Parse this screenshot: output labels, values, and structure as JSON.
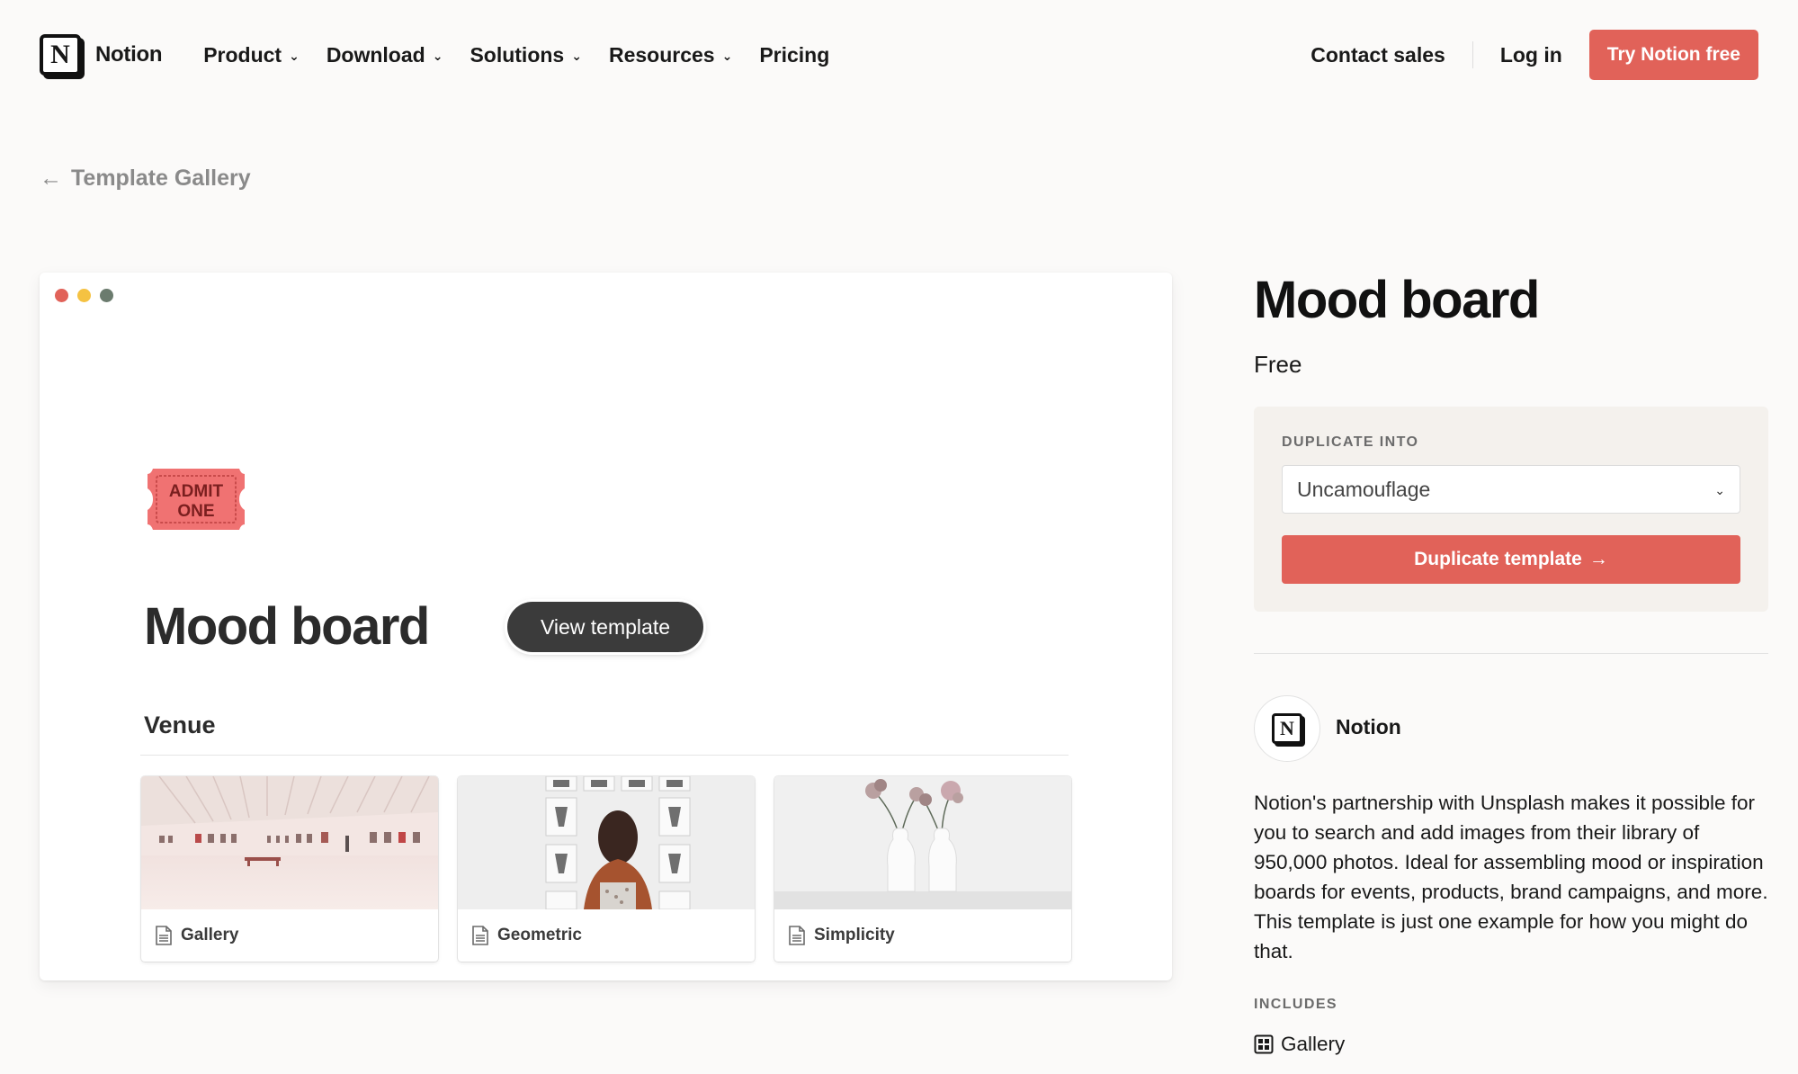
{
  "nav": {
    "brand": "Notion",
    "menu": [
      {
        "label": "Product",
        "has_dropdown": true
      },
      {
        "label": "Download",
        "has_dropdown": true
      },
      {
        "label": "Solutions",
        "has_dropdown": true
      },
      {
        "label": "Resources",
        "has_dropdown": true
      },
      {
        "label": "Pricing",
        "has_dropdown": false
      }
    ],
    "contact_sales": "Contact sales",
    "login": "Log in",
    "try_free": "Try Notion free"
  },
  "back_link": "Template Gallery",
  "preview": {
    "window_dot_colors": [
      "#e16259",
      "#f5c242",
      "#6b7b6e"
    ],
    "icon": "admit-one-ticket-icon",
    "ticket_text_line1": "ADMIT",
    "ticket_text_line2": "ONE",
    "title": "Mood board",
    "view_button": "View template",
    "section_heading": "Venue",
    "cards": [
      {
        "label": "Gallery",
        "image": "white-gallery-hall-photo"
      },
      {
        "label": "Geometric",
        "image": "woman-viewing-framed-prints-photo"
      },
      {
        "label": "Simplicity",
        "image": "white-vases-with-flowers-photo"
      }
    ]
  },
  "sidebar": {
    "title": "Mood board",
    "price": "Free",
    "duplicate_label": "DUPLICATE INTO",
    "duplicate_select_value": "Uncamouflage",
    "duplicate_button": "Duplicate template",
    "duplicate_button_arrow": "→",
    "author": "Notion",
    "description": "Notion's partnership with Unsplash makes it possible for you to search and add images from their library of 950,000 photos. Ideal for assembling mood or inspiration boards for events, products, brand campaigns, and more. This template is just one example for how you might do that.",
    "includes_label": "INCLUDES",
    "includes_items": [
      "Gallery"
    ]
  },
  "colors": {
    "accent": "#e16259",
    "background": "#fbfaf9",
    "panel": "#f4f1ed",
    "dark_button": "#3b3b3b"
  }
}
